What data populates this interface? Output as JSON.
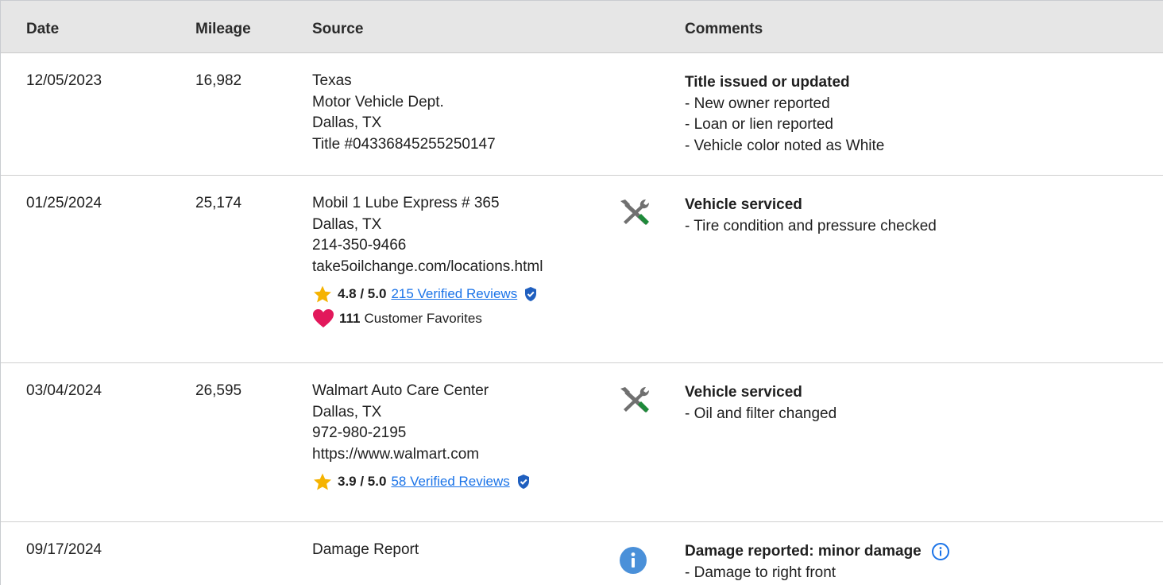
{
  "header": {
    "date": "Date",
    "mileage": "Mileage",
    "source": "Source",
    "comments": "Comments"
  },
  "colors": {
    "header_bg": "#e6e6e6",
    "link": "#1a73e8",
    "star": "#f5b301",
    "heart": "#e2185b",
    "service_icon_tool": "#707070",
    "service_icon_handle": "#1e8a3a",
    "info_icon": "#4a90d9"
  },
  "rows": [
    {
      "date": "12/05/2023",
      "mileage": "16,982",
      "source": [
        "Texas",
        "Motor Vehicle Dept.",
        "Dallas, TX",
        "Title #04336845255250147"
      ],
      "icon": "",
      "comment_title": "Title issued or updated",
      "comment_lines": [
        "- New owner reported",
        "- Loan or lien reported",
        "- Vehicle color noted as White"
      ]
    },
    {
      "date": "01/25/2024",
      "mileage": "25,174",
      "source": [
        "Mobil 1 Lube Express # 365",
        "Dallas, TX",
        "214-350-9466",
        "take5oilchange.com/locations.html"
      ],
      "rating": {
        "score": "4.8 / 5.0",
        "reviews": "215 Verified Reviews"
      },
      "favorites": {
        "count": "111",
        "label": "Customer Favorites"
      },
      "icon": "service-icon",
      "comment_title": "Vehicle serviced",
      "comment_lines": [
        "- Tire condition and pressure checked"
      ]
    },
    {
      "date": "03/04/2024",
      "mileage": "26,595",
      "source": [
        "Walmart Auto Care Center",
        "Dallas, TX",
        "972-980-2195",
        "https://www.walmart.com"
      ],
      "rating": {
        "score": "3.9 / 5.0",
        "reviews": "58 Verified Reviews"
      },
      "icon": "service-icon",
      "comment_title": "Vehicle serviced",
      "comment_lines": [
        "- Oil and filter changed"
      ]
    },
    {
      "date": "09/17/2024",
      "mileage": "",
      "source": [
        "Damage Report"
      ],
      "icon": "info-icon",
      "comment_title": "Damage reported: minor damage",
      "comment_lines": [
        "- Damage to right front"
      ]
    }
  ]
}
